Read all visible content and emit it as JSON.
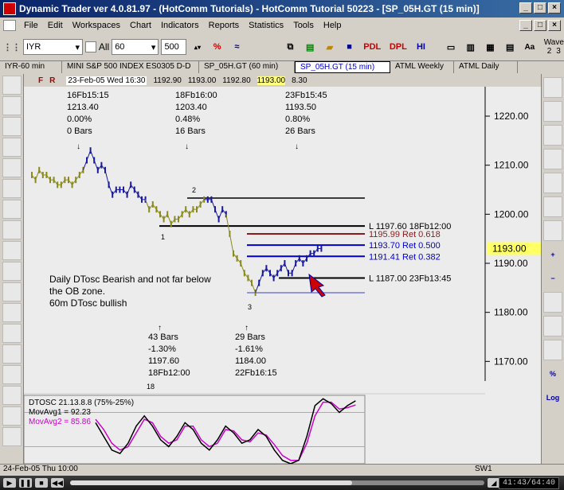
{
  "window": {
    "title": "Dynamic Trader ver 4.0.81.97 - (HotComm Tutorials) - HotComm Tutorial 50223 - [SP_05H.GT (15 min)]",
    "controls": [
      "_",
      "□",
      "×"
    ]
  },
  "menubar": {
    "items": [
      "File",
      "Edit",
      "Workspaces",
      "Chart",
      "Indicators",
      "Reports",
      "Statistics",
      "Tools",
      "Help"
    ]
  },
  "toolbar": {
    "symbol_value": "IYR",
    "all_label": "All",
    "period_value": "60",
    "bars_value": "500",
    "btn_pdl": "PDL",
    "btn_dpl": "DPL",
    "btn_hi": "HI",
    "wave_label": "Wave",
    "wave_nums": [
      "2",
      "3"
    ]
  },
  "tabs": [
    {
      "label": "IYR-60 min"
    },
    {
      "label": "MINI S&P 500 INDEX ES0305 D-D"
    },
    {
      "label": "SP_05H.GT (60 min)"
    },
    {
      "label": "SP_05H.GT (15 min)",
      "active": true
    },
    {
      "label": "ATML Weekly"
    },
    {
      "label": "ATML Daily"
    }
  ],
  "infobar": {
    "f": "F",
    "r": "R",
    "date": "23-Feb-05 Wed 16:30",
    "open": "1192.90",
    "high": "1193.00",
    "low": "1192.80",
    "close": "1193.00",
    "range": "8.30"
  },
  "chart_data": {
    "type": "line",
    "price_axis": [
      "1220.00",
      "1210.00",
      "1200.00",
      "1193.00",
      "1190.00",
      "1180.00",
      "1170.00"
    ],
    "current_price": "1193.00",
    "ylim": [
      1166,
      1226
    ],
    "swing_labels": {
      "top": [
        {
          "date": "16Fb15:15",
          "price": "1213.40",
          "pct": "0.00%",
          "bars": "0 Bars"
        },
        {
          "date": "18Fb16:00",
          "price": "1203.40",
          "pct": "0.48%",
          "bars": "16 Bars"
        },
        {
          "date": "23Fb15:45",
          "price": "1193.50",
          "pct": "0.80%",
          "bars": "26 Bars"
        }
      ],
      "bottom": [
        {
          "bars": "43 Bars",
          "pct": "-1.30%",
          "price": "1197.60",
          "date": "18Fb12:00"
        },
        {
          "bars": "29 Bars",
          "pct": "-1.61%",
          "price": "1184.00",
          "date": "22Fb16:15"
        }
      ]
    },
    "levels": [
      {
        "label": "L 1197.60 18Fb12:00",
        "price": 1197.6,
        "color": "#000000"
      },
      {
        "label": "1195.99 Ret 0.618",
        "price": 1195.99,
        "color": "#8b1a1a"
      },
      {
        "label": "1193.70 Ret 0.500",
        "price": 1193.7,
        "color": "#0000cc"
      },
      {
        "label": "1191.41 Ret 0.382",
        "price": 1191.41,
        "color": "#0000cc"
      },
      {
        "label": "L 1187.00 23Fb13:45",
        "price": 1187.0,
        "color": "#000000"
      }
    ],
    "upper_line_price": 1203.3,
    "pivot_labels": [
      "1",
      "2",
      "3"
    ],
    "date_marker": "18",
    "annotation_lines": [
      "Daily DTosc Bearish and not far below",
      "the OB zone.",
      "60m DTosc bullish"
    ],
    "price_series": [
      1208,
      1207,
      1209,
      1208,
      1208,
      1207,
      1207,
      1206,
      1206,
      1207,
      1207,
      1206,
      1207,
      1208,
      1209,
      1211,
      1213,
      1211,
      1209,
      1210,
      1209,
      1206,
      1204,
      1205,
      1205,
      1205,
      1204,
      1206,
      1205,
      1204,
      1203,
      1203,
      1201,
      1202,
      1201,
      1200,
      1199,
      1200,
      1198,
      1199,
      1199,
      1200,
      1201,
      1200,
      1201,
      1201,
      1202,
      1203,
      1203,
      1203,
      1201,
      1199,
      1201,
      1200,
      1196,
      1192,
      1191,
      1190,
      1188,
      1187,
      1186,
      1184,
      1186,
      1188,
      1189,
      1188,
      1187,
      1188,
      1189,
      1190,
      1188,
      1188,
      1190,
      1191,
      1190,
      1191,
      1192,
      1192,
      1193,
      1193
    ]
  },
  "oscillator": {
    "title": "DTOSC 21.13.8.8 (75%-25%)",
    "ma1": "MovAvg1 = 92.23",
    "ma2": "MovAvg2 = 85.86",
    "ma1_color": "#000000",
    "ma2_color": "#cc00cc",
    "series1": [
      60,
      40,
      20,
      15,
      30,
      55,
      70,
      55,
      35,
      25,
      40,
      60,
      50,
      30,
      20,
      35,
      55,
      45,
      30,
      35,
      50,
      40,
      20,
      5,
      0,
      5,
      40,
      85,
      95,
      88,
      75,
      85,
      92
    ],
    "series2": [
      65,
      50,
      30,
      20,
      25,
      45,
      65,
      60,
      40,
      30,
      35,
      55,
      55,
      35,
      25,
      30,
      50,
      48,
      35,
      32,
      45,
      42,
      28,
      12,
      5,
      5,
      30,
      70,
      90,
      90,
      80,
      82,
      86
    ]
  },
  "statusbar": {
    "date": "24-Feb-05 Thu 10:00",
    "sw": "SW1"
  },
  "player": {
    "time": "41:43/64:40",
    "progress": 0.68
  },
  "left_tools": [
    "cursor",
    "line",
    "line2",
    "fib",
    "R",
    "E",
    "T",
    "PT",
    "wave",
    "COW",
    "PRICE",
    "PCT",
    "FIB",
    "TIME",
    "DATE",
    "cycle",
    "abc",
    "S"
  ],
  "right_tools": [
    "zoom",
    "zoom-out",
    "down",
    "up",
    "arrows-lr",
    "arrows",
    "wave",
    "plus",
    "minus",
    "magnet",
    "zero",
    "hot",
    "pct",
    "log"
  ],
  "right_tool_labels": {
    "pct": "%",
    "log": "Log",
    "plus": "+",
    "minus": "−"
  }
}
